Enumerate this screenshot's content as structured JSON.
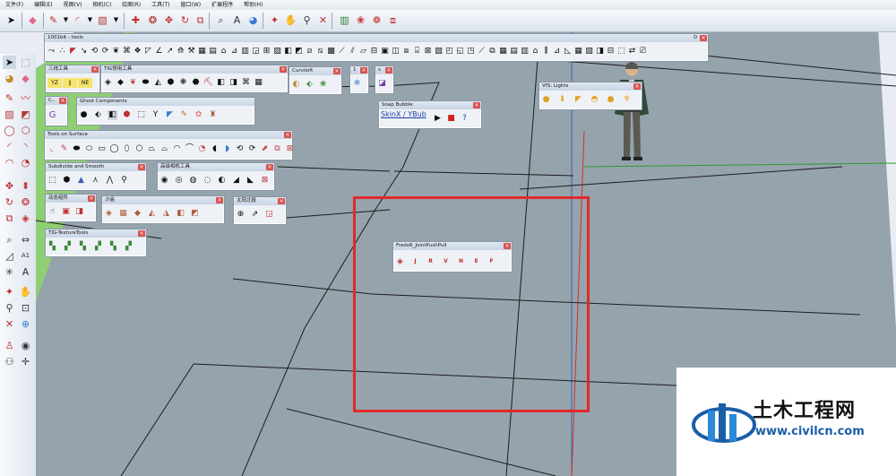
{
  "menu": [
    "文件(F)",
    "编辑(E)",
    "视图(V)",
    "相机(C)",
    "绘图(R)",
    "工具(T)",
    "窗口(W)",
    "扩展程序",
    "帮助(H)"
  ],
  "main_toolbar_icons": [
    "select-arrow-icon",
    "eraser-icon",
    "pencil-icon",
    "arc-icon",
    "shape-rectangle-icon",
    "push-pull-icon",
    "move-icon",
    "rotate-icon",
    "offset-icon",
    "tape-measure-icon",
    "text-icon",
    "paint-bucket-icon",
    "orbit-icon",
    "pan-icon",
    "zoom-icon",
    "zoom-extents-icon",
    "components-icon",
    "model-info-icon",
    "share-icon"
  ],
  "panels": {
    "bit1001": {
      "title": "1001bit - tools",
      "minimized_label": "D"
    },
    "sanxian": {
      "title": "三线工具",
      "icons": [
        "YZ",
        "∥",
        "NE"
      ]
    },
    "tig": {
      "title": "TIG常用工具"
    },
    "curviloft": {
      "title": "Curviloft"
    },
    "small1": {
      "title": "1"
    },
    "small2": {
      "title": "s"
    },
    "c_panel": {
      "title": "C.."
    },
    "ghost": {
      "title": "Ghost Components"
    },
    "tools_surface": {
      "title": "Tools on Surface"
    },
    "subdivide": {
      "title": "Subdivide and Smooth"
    },
    "camera": {
      "title": "高级相机工具"
    },
    "dynamic": {
      "title": "动态组件"
    },
    "sandbox": {
      "title": "沙盒"
    },
    "solar": {
      "title": "太阳北极"
    },
    "texture": {
      "title": "TIG-TextureTools"
    },
    "soap": {
      "title": "Soap Bubble",
      "label": "SkinX / YBub"
    },
    "lights": {
      "title": "VfS: Lights"
    },
    "jpp": {
      "title": "Fredo6_JointPushPull",
      "buttons": [
        "J",
        "R",
        "V",
        "N",
        "E",
        "F"
      ]
    }
  },
  "watermark": {
    "name": "土木工程网",
    "url": "www.civilcn.com"
  },
  "colors": {
    "highlight": "#e02a2a",
    "viewport": "#95a3ac",
    "ground": "#8fcf73",
    "logo_blue": "#1a5ea8"
  }
}
